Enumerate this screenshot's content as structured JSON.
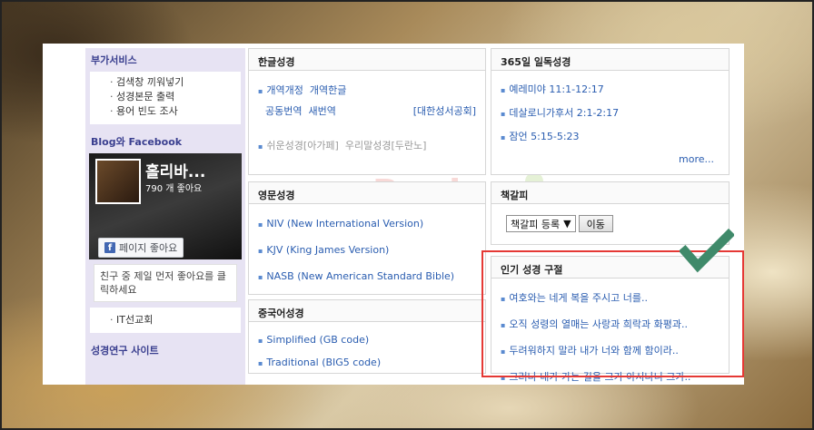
{
  "extra_services": {
    "title": "부가서비스",
    "items": [
      "검색창 끼워넣기",
      "성경본문 출력",
      "용어 빈도 조사"
    ]
  },
  "blog_facebook": {
    "title": "Blog와 Facebook",
    "fb_name": "홀리바...",
    "fb_likes": "790 개 좋아요",
    "fb_like_button": "페이지 좋아요",
    "fb_message": "친구 중 제일 먼저 좋아요를 클릭하세요",
    "link": "IT선교회"
  },
  "research_sites": {
    "title": "성경연구 사이트"
  },
  "korean_bible": {
    "title": "한글성경",
    "links": [
      "개역개정",
      "개역한글",
      "공동번역",
      "새번역",
      "[대한성서공회]",
      "쉬운성경[아가페]",
      "우리말성경[두란노]"
    ]
  },
  "english_bible": {
    "title": "영문성경",
    "links": [
      "NIV (New International Version)",
      "KJV (King James Version)",
      "NASB (New American Standard Bible)"
    ]
  },
  "chinese_bible": {
    "title": "중국어성경",
    "links": [
      "Simplified (GB code)",
      "Traditional (BIG5 code)"
    ]
  },
  "daily_reading": {
    "title": "365일 일독성경",
    "links": [
      "예레미야 11:1-12:17",
      "데살로니가후서 2:1-2:17",
      "잠언 5:15-5:23"
    ],
    "more": "more..."
  },
  "bookmark": {
    "title": "책갈피",
    "select_value": "책갈피 등록",
    "go_button": "이동"
  },
  "popular_verses": {
    "title": "인기 성경 구절",
    "links": [
      "여호와는 네게 복을 주시고 너를..",
      "오직 성령의 열매는 사랑과 희락과 화평과..",
      "두려워하지 말라 내가 너와 함께 함이라..",
      "그러나 내가 가는 길을 그가 아시나니 그가.."
    ]
  },
  "watermark": "Book",
  "colors": {
    "accent_link": "#2a5db0",
    "highlight_box": "#e53935",
    "check_mark": "#3f8a6a",
    "sidebar_bg": "#e7e3f3"
  }
}
